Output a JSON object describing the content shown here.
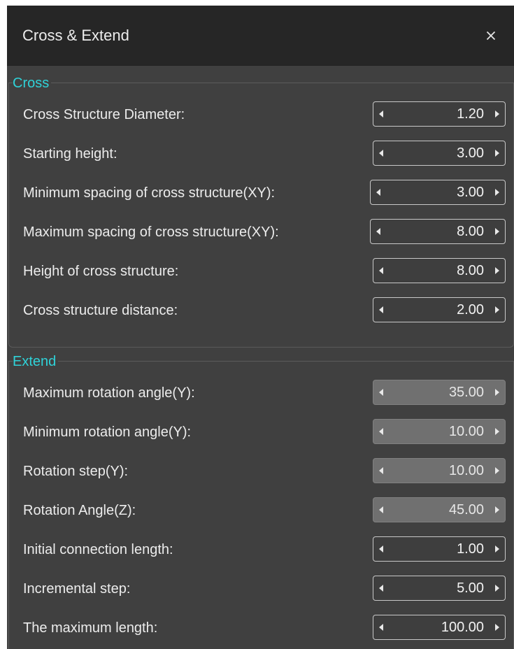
{
  "dialog": {
    "title": "Cross & Extend",
    "close_icon": "close-icon"
  },
  "cross": {
    "title": "Cross",
    "rows": [
      {
        "label": "Cross Structure Diameter:",
        "value": "1.20",
        "enabled": true
      },
      {
        "label": "Starting height:",
        "value": "3.00",
        "enabled": true
      },
      {
        "label": "Minimum spacing of cross structure(XY):",
        "value": "3.00",
        "enabled": true
      },
      {
        "label": "Maximum spacing of cross structure(XY):",
        "value": "8.00",
        "enabled": true
      },
      {
        "label": "Height of cross structure:",
        "value": "8.00",
        "enabled": true
      },
      {
        "label": "Cross structure distance:",
        "value": "2.00",
        "enabled": true
      }
    ]
  },
  "extend": {
    "title": "Extend",
    "rows": [
      {
        "label": "Maximum rotation angle(Y):",
        "value": "35.00",
        "enabled": false
      },
      {
        "label": "Minimum rotation angle(Y):",
        "value": "10.00",
        "enabled": false
      },
      {
        "label": "Rotation step(Y):",
        "value": "10.00",
        "enabled": false
      },
      {
        "label": "Rotation Angle(Z):",
        "value": "45.00",
        "enabled": false
      },
      {
        "label": "Initial connection length:",
        "value": "1.00",
        "enabled": true
      },
      {
        "label": "Incremental step:",
        "value": "5.00",
        "enabled": true
      },
      {
        "label": "The maximum length:",
        "value": "100.00",
        "enabled": true
      }
    ]
  },
  "colors": {
    "titlebar": "#262626",
    "panel": "#404040",
    "group_title": "#2fd2d8",
    "disabled_field": "#707070"
  }
}
